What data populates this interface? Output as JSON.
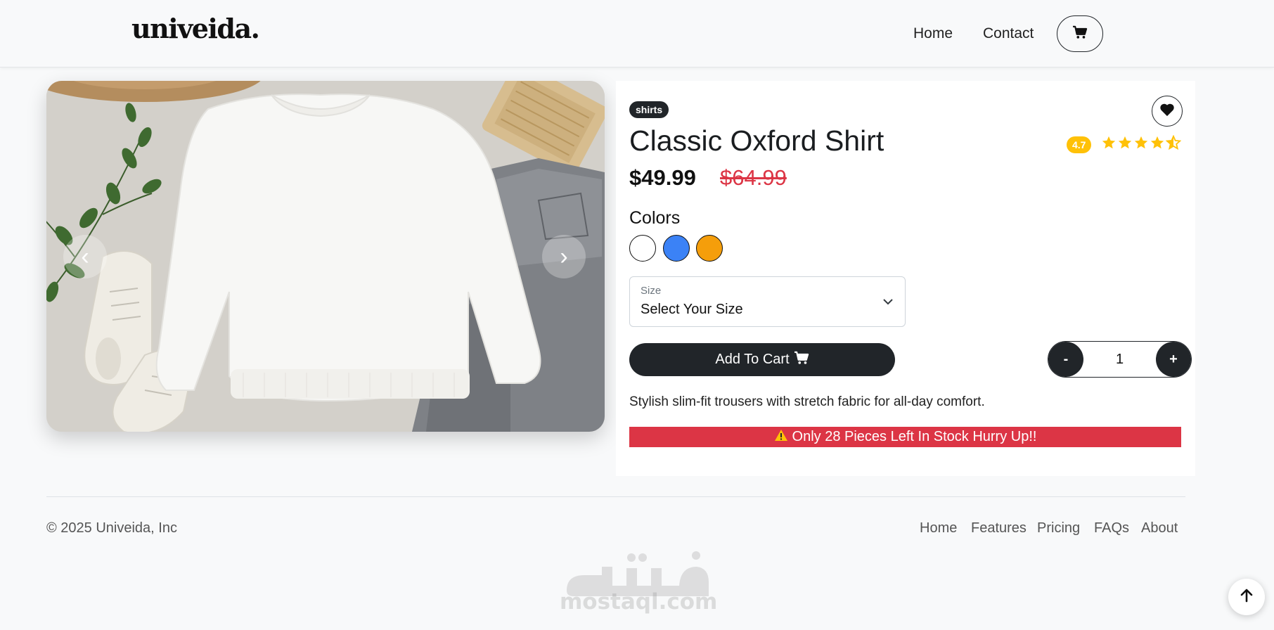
{
  "navbar": {
    "brand": "univeida.",
    "links": [
      "Home",
      "Contact"
    ],
    "cart_icon": "cart-icon"
  },
  "gallery": {
    "prev_label": "‹",
    "next_label": "›"
  },
  "product": {
    "category_badge": "shirts",
    "name": "Classic Oxford Shirt",
    "rating": "4.7",
    "rating_stars": 4.5,
    "price": "$49.99",
    "old_price": "$64.99",
    "colors_label": "Colors",
    "colors": [
      "#ffffff",
      "#3b82f6",
      "#f59e0b"
    ],
    "size_label": "Size",
    "size_value": "Select Your Size",
    "add_to_cart_label": "Add To Cart",
    "quantity": {
      "minus": "-",
      "value": "1",
      "plus": "+"
    },
    "description": "Stylish slim-fit trousers with stretch fabric for all-day comfort.",
    "stock_alert": "Only 28 Pieces Left In Stock Hurry Up!!"
  },
  "footer": {
    "copyright": "© 2025 Univeida, Inc",
    "links": [
      "Home",
      "Features",
      "Pricing",
      "FAQs",
      "About"
    ]
  },
  "watermark": {
    "text": "mostaql.com"
  },
  "colors": {
    "dark": "#212529",
    "danger": "#dc3545",
    "warning": "#ffc107",
    "background": "#f8f9fa"
  }
}
